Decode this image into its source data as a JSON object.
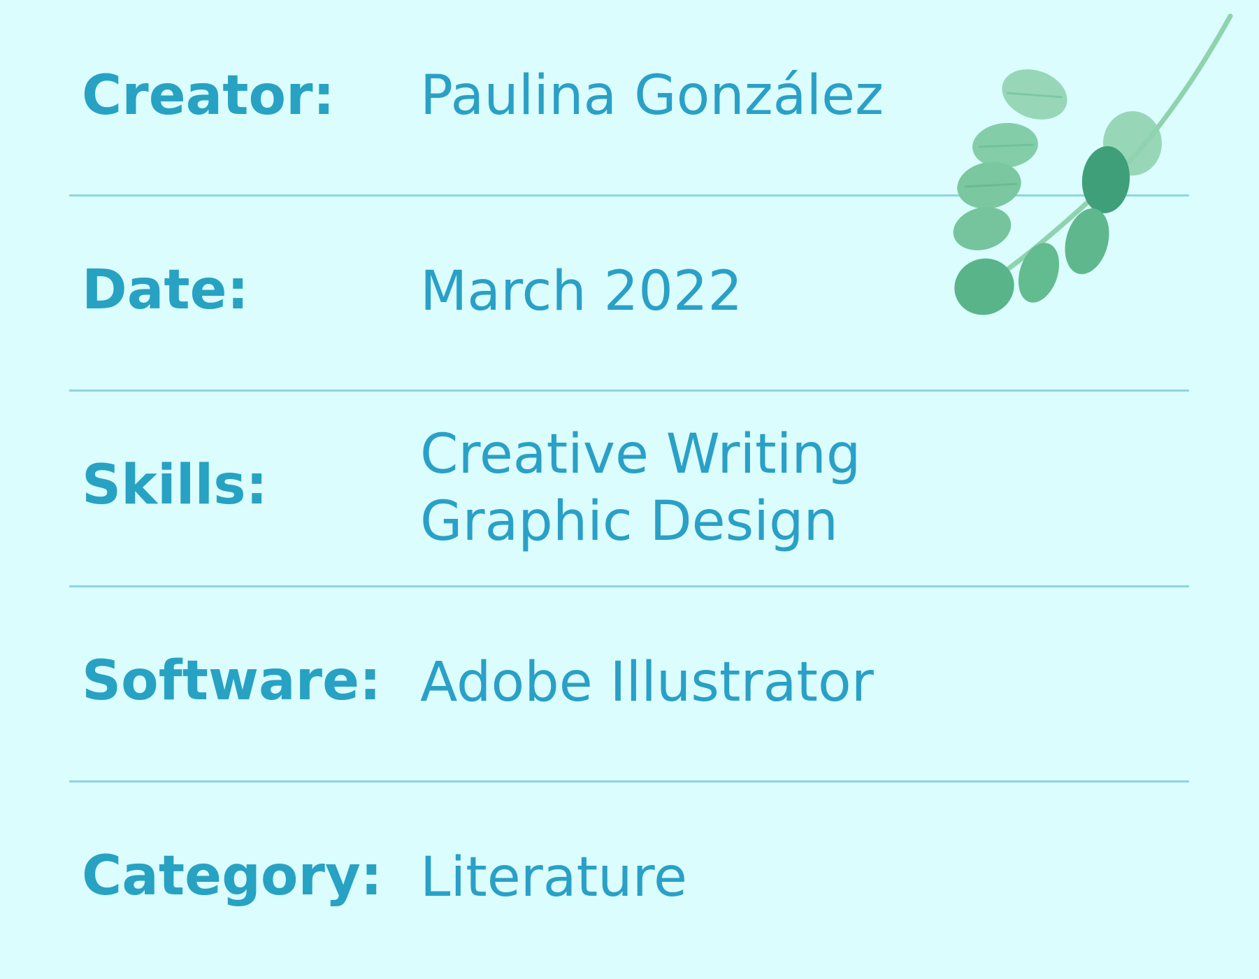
{
  "details": {
    "rows": [
      {
        "label": "Creator:",
        "value": "Paulina González"
      },
      {
        "label": "Date:",
        "value": "March 2022"
      },
      {
        "label": "Skills:",
        "values": [
          "Creative Writing",
          "Graphic Design"
        ]
      },
      {
        "label": "Software:",
        "value": "Adobe Illustrator"
      },
      {
        "label": "Category:",
        "value": "Literature"
      }
    ]
  },
  "decoration": {
    "icon": "eucalyptus-sprig-icon"
  },
  "colors": {
    "background": "#dbfdfe",
    "label": "#27a2c3",
    "value": "#2aa0c6",
    "divider": "#8fd5e1",
    "leaf": "#6cc39a",
    "leaf_dark": "#2f9b72"
  }
}
